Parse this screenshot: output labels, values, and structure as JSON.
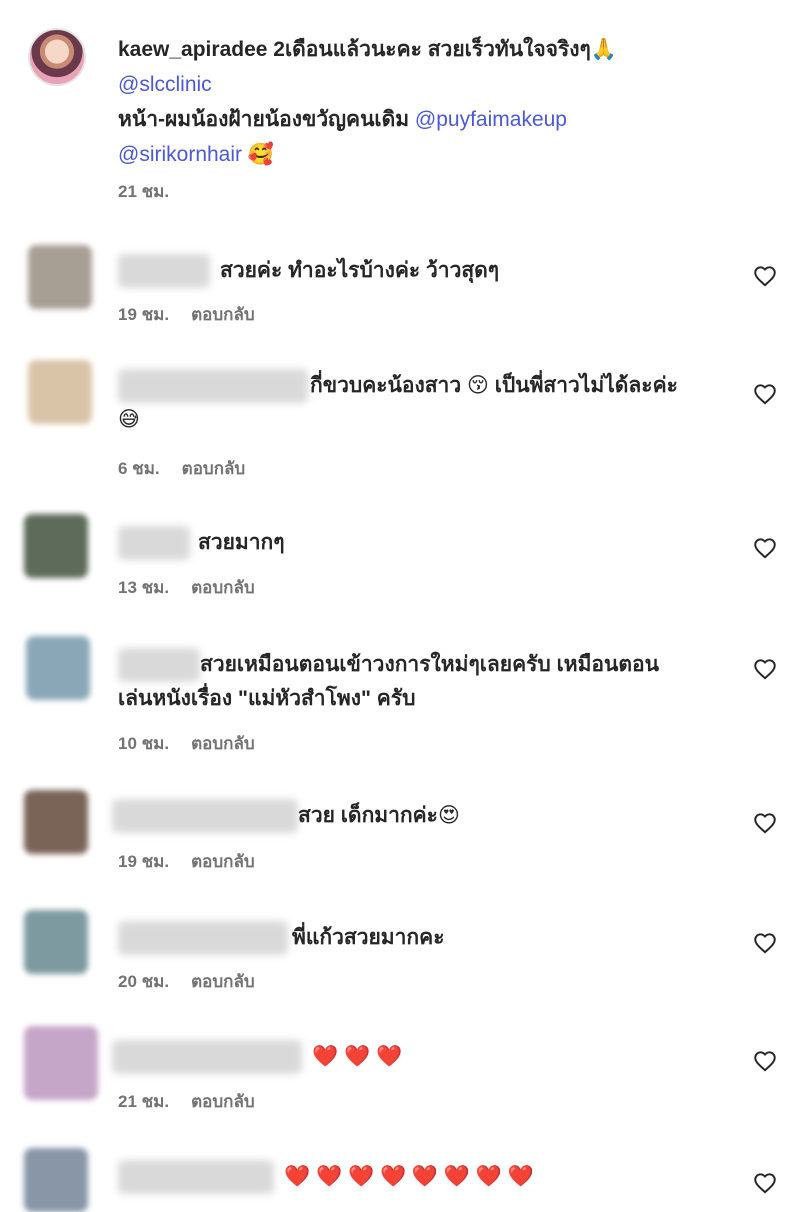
{
  "caption": {
    "username": "kaew_apiradee",
    "text_line1": "2เดือนแล้วนะคะ สวยเร็วทันใจจริงๆ",
    "emoji1": "🙏",
    "mention1": "@slcclinic",
    "text_line2": "หน้า-ผมน้องฝ้ายน้องขวัญคนเดิม",
    "mention2": "@puyfaimakeup",
    "mention3": "@sirikornhair",
    "emoji2": "🥰",
    "time": "21 ชม."
  },
  "reply_label": "ตอบกลับ",
  "comments": [
    {
      "text": "สวยค่ะ ทำอะไรบ้างค่ะ ว้าวสุดๆ",
      "time": "19 ชม.",
      "avatar_color": "#a89f94"
    },
    {
      "text": "กี่ขวบคะน้องสาว 😚 เป็นพี่สาวไม่ได้ละค่ะ",
      "text2": "😅",
      "time": "6 ชม.",
      "avatar_color": "#d9c4a8"
    },
    {
      "text": "สวยมากๆ",
      "time": "13 ชม.",
      "avatar_color": "#5e6a5a"
    },
    {
      "text": "สวยเหมือนตอนเข้าวงการใหม่ๆเลยครับ เหมือนตอน",
      "text2": "เล่นหนังเรื่อง \"แม่หัวสำโพง\" ครับ",
      "time": "10 ชม.",
      "avatar_color": "#8aa7b8"
    },
    {
      "text": "สวย เด็กมากค่ะ😍",
      "time": "19 ชม.",
      "avatar_color": "#7a6458"
    },
    {
      "text": "พี่แก้วสวยมากคะ",
      "time": "20 ชม.",
      "avatar_color": "#7d9aa0"
    },
    {
      "text": "❤️ ❤️ ❤️",
      "time": "21 ชม.",
      "avatar_color": "#c6a6c8"
    },
    {
      "text": "❤️ ❤️ ❤️ ❤️ ❤️ ❤️ ❤️ ❤️",
      "time": "",
      "avatar_color": "#8896a8"
    }
  ]
}
